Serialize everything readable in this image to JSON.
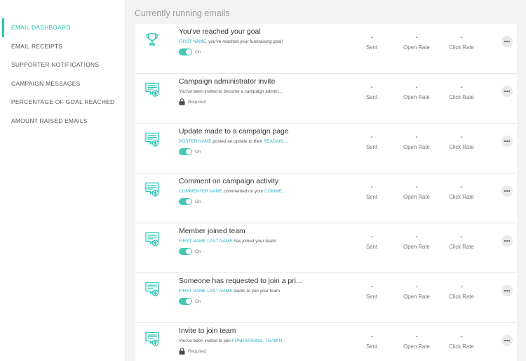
{
  "colors": {
    "accent": "#2fc5b3",
    "token": "#2fb4c9",
    "toggle": "#47c6b2"
  },
  "sidebar": {
    "items": [
      {
        "label": "EMAIL DASHBOARD",
        "active": true
      },
      {
        "label": "EMAIL RECEIPTS"
      },
      {
        "label": "SUPPORTER NOTIFICATIONS"
      },
      {
        "label": "CAMPAIGN MESSAGES"
      },
      {
        "label": "PERCENTAGE OF GOAL REACHED"
      },
      {
        "label": "AMOUNT RAISED EMAILS"
      }
    ]
  },
  "main": {
    "title": "Currently running emails",
    "stat_labels": {
      "sent": "Sent",
      "open": "Open Rate",
      "click": "Click Rate"
    },
    "rows": [
      {
        "icon": "trophy-icon",
        "title": "You've reached your goal",
        "desc": [
          {
            "t": "FIRST NAME",
            "token": true
          },
          {
            "t": ", you've reached your fundraising goal!"
          }
        ],
        "status": "On",
        "status_type": "toggle",
        "sent": "-",
        "open": "-",
        "click": "-"
      },
      {
        "icon": "message-dollar-icon",
        "title": "Campaign administrator invite",
        "desc": [
          {
            "t": "You've been invited to become a campaign admini..."
          }
        ],
        "status": "Required",
        "status_type": "lock",
        "sent": "-",
        "open": "-",
        "click": "-"
      },
      {
        "icon": "message-dollar-icon",
        "title": "Update made to a campaign page",
        "desc": [
          {
            "t": "POSTER NAME",
            "token": true
          },
          {
            "t": " posted an update to their "
          },
          {
            "t": "READABL...",
            "token": true
          }
        ],
        "status": "On",
        "status_type": "toggle",
        "sent": "-",
        "open": "-",
        "click": "-"
      },
      {
        "icon": "message-dollar-icon",
        "title": "Comment on campaign activity",
        "desc": [
          {
            "t": "COMMENTER NAME",
            "token": true
          },
          {
            "t": " commented on your "
          },
          {
            "t": "COMME...",
            "token": true
          }
        ],
        "status": "On",
        "status_type": "toggle",
        "sent": "-",
        "open": "-",
        "click": "-"
      },
      {
        "icon": "message-dollar-icon",
        "title": "Member joined team",
        "desc": [
          {
            "t": "FIRST NAME LAST NAME",
            "token": true
          },
          {
            "t": " has joined your team!"
          }
        ],
        "status": "On",
        "status_type": "toggle",
        "sent": "-",
        "open": "-",
        "click": "-"
      },
      {
        "icon": "message-dollar-icon",
        "title": "Someone has requested to join a pri...",
        "desc": [
          {
            "t": "FIRST NAME LAST NAME",
            "token": true
          },
          {
            "t": " wants to join your team"
          }
        ],
        "status": "On",
        "status_type": "toggle",
        "sent": "-",
        "open": "-",
        "click": "-"
      },
      {
        "icon": "message-dollar-icon",
        "title": "Invite to join team",
        "desc": [
          {
            "t": "You've been invited to join "
          },
          {
            "t": "FUNDRAISING_TEAM N...",
            "token": true
          }
        ],
        "status": "Required",
        "status_type": "lock",
        "sent": "-",
        "open": "-",
        "click": "-"
      }
    ]
  }
}
